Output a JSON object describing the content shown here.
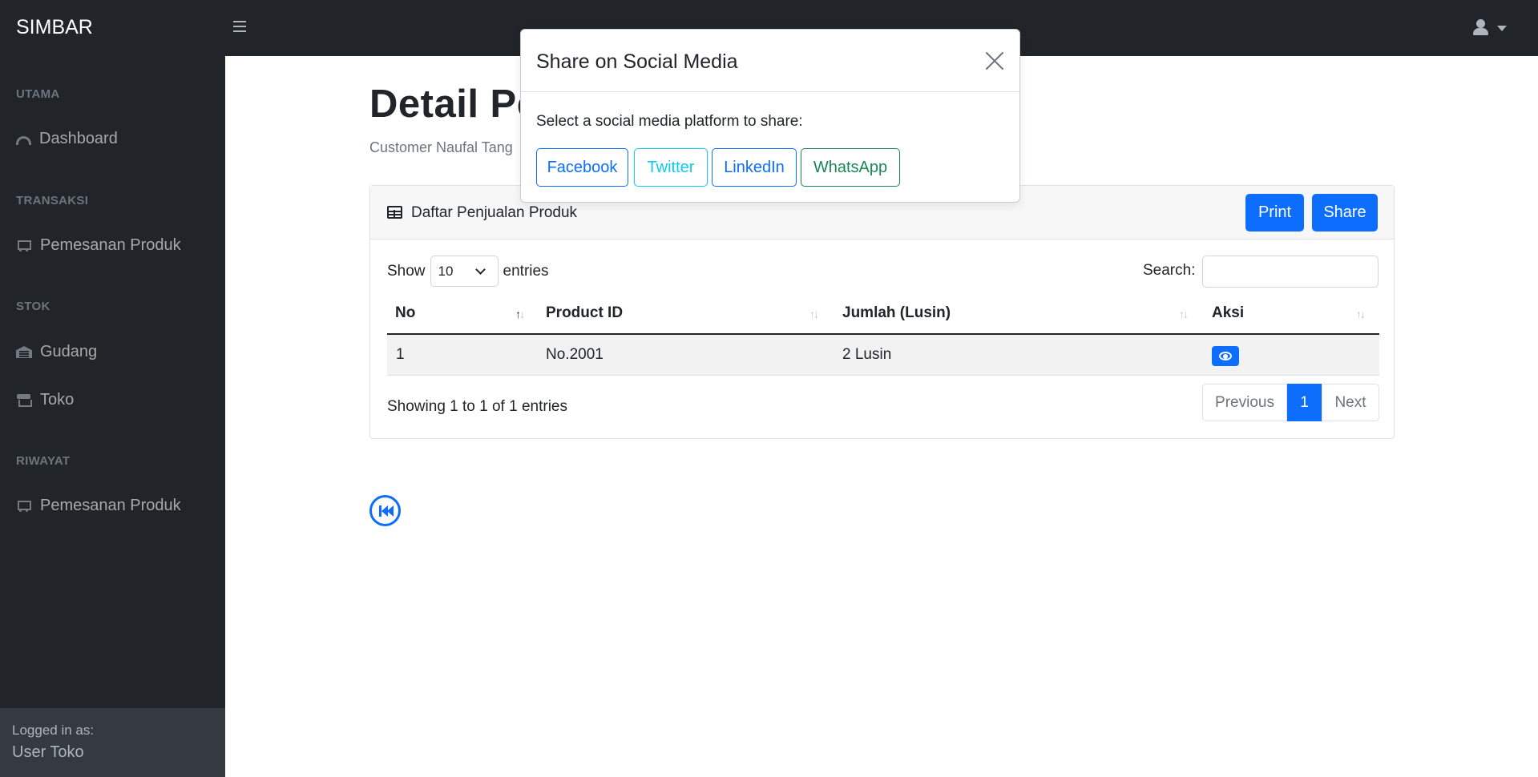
{
  "app": {
    "brand": "SIMBAR"
  },
  "sidebar": {
    "sections": [
      {
        "heading": "UTAMA",
        "items": [
          {
            "label": "Dashboard",
            "icon": "gauge-icon"
          }
        ]
      },
      {
        "heading": "TRANSAKSI",
        "items": [
          {
            "label": "Pemesanan Produk",
            "icon": "cart-icon"
          }
        ]
      },
      {
        "heading": "STOK",
        "items": [
          {
            "label": "Gudang",
            "icon": "warehouse-icon"
          },
          {
            "label": "Toko",
            "icon": "store-icon"
          }
        ]
      },
      {
        "heading": "RIWAYAT",
        "items": [
          {
            "label": "Pemesanan Produk",
            "icon": "cart-icon"
          }
        ]
      }
    ],
    "footer": {
      "label": "Logged in as:",
      "user": "User Toko"
    }
  },
  "main": {
    "title": "Detail Pe",
    "breadcrumb": "Customer Naufal Tang"
  },
  "card": {
    "title": "Daftar Penjualan Produk",
    "print_label": "Print",
    "share_label": "Share",
    "show_label": "Show",
    "entries_value": "10",
    "entries_label": "entries",
    "search_label": "Search:",
    "search_value": "",
    "columns": [
      "No",
      "Product ID",
      "Jumlah (Lusin)",
      "Aksi"
    ],
    "rows": [
      {
        "no": "1",
        "product_id": "No.2001",
        "jumlah": "2 Lusin",
        "action_icon": "eye-icon"
      }
    ],
    "info": "Showing 1 to 1 of 1 entries",
    "pagination": {
      "previous": "Previous",
      "current": "1",
      "next": "Next"
    }
  },
  "modal": {
    "title": "Share on Social Media",
    "body": "Select a social media platform to share:",
    "buttons": [
      "Facebook",
      "Twitter",
      "LinkedIn",
      "WhatsApp"
    ]
  },
  "colors": {
    "primary": "#0d6efd",
    "dark": "#212529",
    "twitter": "#0dcaf0",
    "whatsapp": "#198754"
  }
}
